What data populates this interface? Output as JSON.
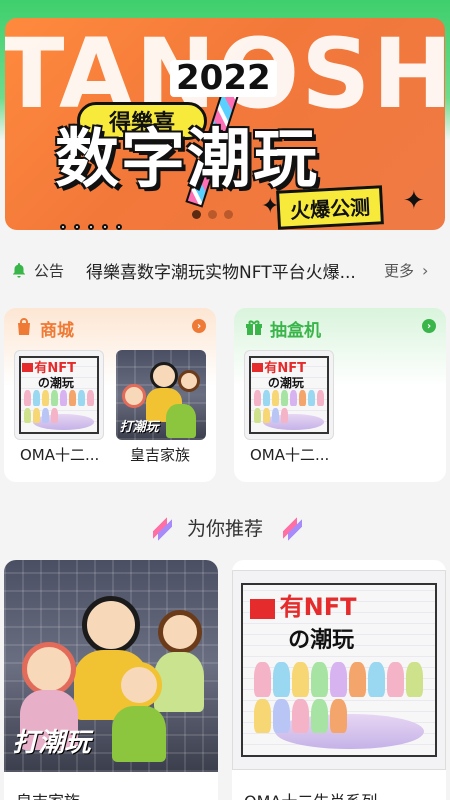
{
  "banner": {
    "bg_word": "TANOSHI",
    "year": "2022",
    "pill": "得樂喜",
    "headline": "数字潮玩",
    "sub": "火爆公测",
    "pages": 3,
    "active_page": 1
  },
  "notice": {
    "label": "公告",
    "text": "得樂喜数字潮玩实物NFT平台火爆...",
    "more": "更多"
  },
  "categories": {
    "shop": {
      "title": "商城",
      "items": [
        "OMA十二...",
        "皇吉家族"
      ]
    },
    "blindbox": {
      "title": "抽盒机",
      "items": [
        "OMA十二..."
      ]
    }
  },
  "section": {
    "title": "为你推荐"
  },
  "products": [
    {
      "name": "皇吉家族"
    },
    {
      "name": "OMA十二生肖系列"
    }
  ],
  "poster": {
    "line1": "有NFT",
    "line2": "の潮玩"
  },
  "royal": {
    "caption": "打潮玩"
  },
  "colors": {
    "brand_green": "#39b54a",
    "shop_orange": "#ef7a35",
    "banner_orange": "#f2783a"
  }
}
